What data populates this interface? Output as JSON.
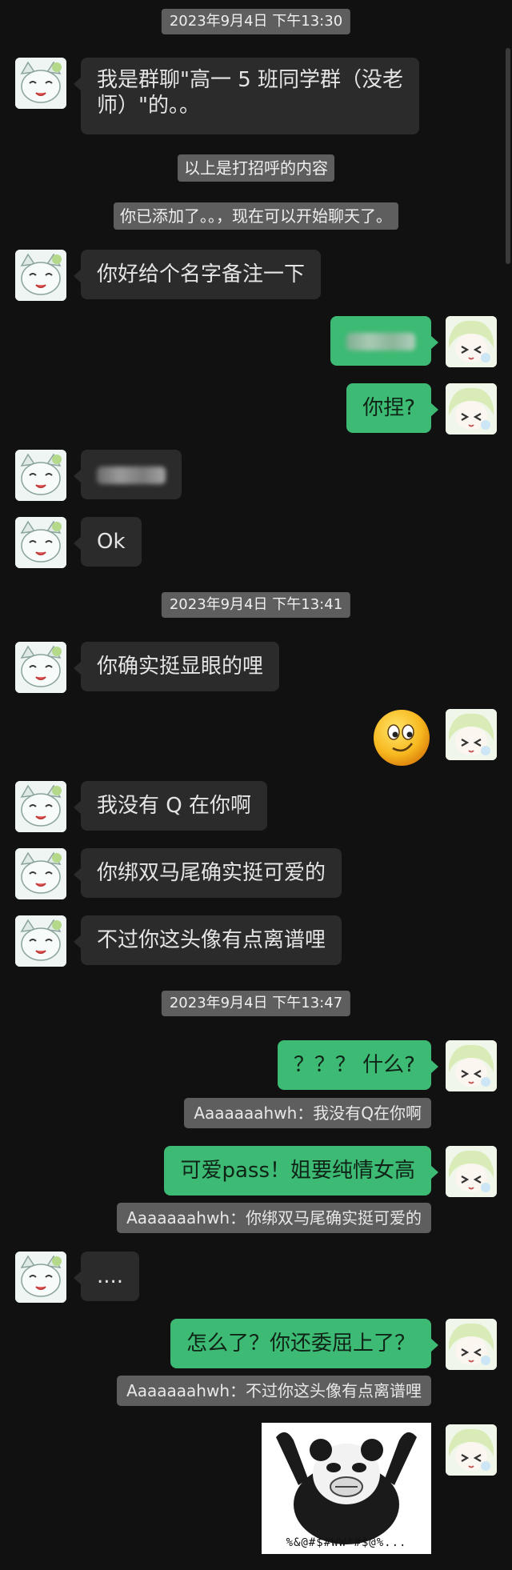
{
  "timestamps": [
    "2023年9月4日 下午13:30",
    "2023年9月4日 下午13:41",
    "2023年9月4日 下午13:47"
  ],
  "system": {
    "greeting_note": "以上是打招呼的内容",
    "added_note": "你已添加了。。，现在可以开始聊天了。"
  },
  "messages": {
    "m1_line1": "我是群聊\"高一 5 班同学群（没老",
    "m1_line2": "师）\"的。。",
    "m2": "你好给个名字备注一下",
    "m4": "你捏?",
    "m6": "Ok",
    "m7": "你确实挺显眼的哩",
    "m9": "我没有 Q 在你啊",
    "m10": "你绑双马尾确实挺可爱的",
    "m11": "不过你这头像有点离谱哩",
    "m12": "？？？ 什么?",
    "m13": "可爱pass！姐要纯情女高",
    "m14": "....",
    "m15": "怎么了？你还委屈上了？"
  },
  "quotes": {
    "q1": "Aaaaaaahwh：我没有Q在你啊",
    "q2": "Aaaaaaahwh：你绑双马尾确实挺可爱的",
    "q3": "Aaaaaaahwh：不过你这头像有点离谱哩"
  },
  "sticker": {
    "caption": "%&@#$#WW*#$@%..."
  },
  "colors": {
    "background": "#111111",
    "bubble_self": "#3dba73",
    "bubble_other": "#2b2b2b",
    "system_label": "#5e5e5e"
  }
}
